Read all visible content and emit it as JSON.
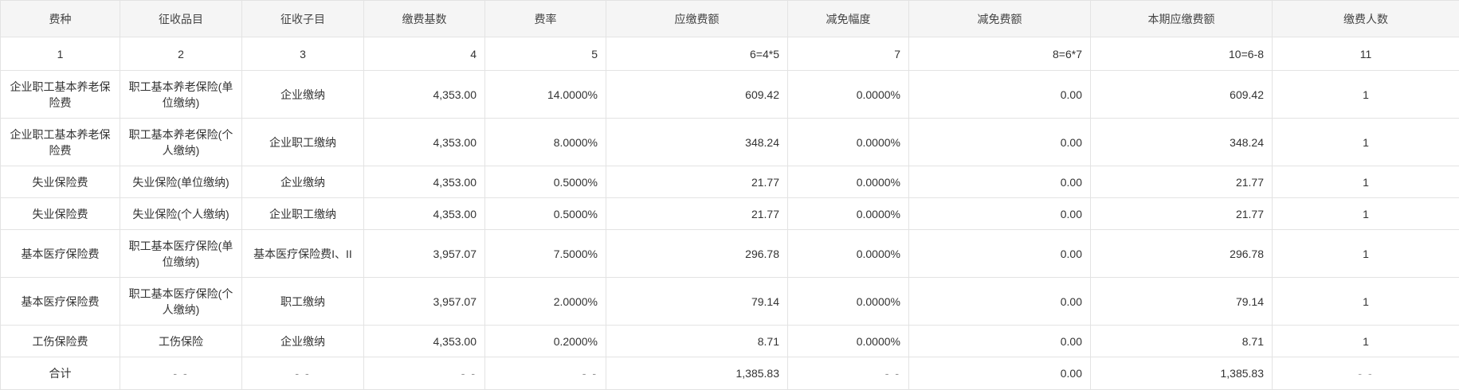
{
  "columns": [
    "费种",
    "征收品目",
    "征收子目",
    "缴费基数",
    "费率",
    "应缴费额",
    "减免幅度",
    "减免费额",
    "本期应缴费额",
    "缴费人数"
  ],
  "index_row": [
    "1",
    "2",
    "3",
    "4",
    "5",
    "6=4*5",
    "7",
    "8=6*7",
    "10=6-8",
    "11"
  ],
  "rows": [
    {
      "fee_type": "企业职工基本养老保险费",
      "item": "职工基本养老保险(单位缴纳)",
      "sub_item": "企业缴纳",
      "base": "4,353.00",
      "rate": "14.0000%",
      "payable": "609.42",
      "reduction_rate": "0.0000%",
      "reduction_amount": "0.00",
      "current_payable": "609.42",
      "payers": "1"
    },
    {
      "fee_type": "企业职工基本养老保险费",
      "item": "职工基本养老保险(个人缴纳)",
      "sub_item": "企业职工缴纳",
      "base": "4,353.00",
      "rate": "8.0000%",
      "payable": "348.24",
      "reduction_rate": "0.0000%",
      "reduction_amount": "0.00",
      "current_payable": "348.24",
      "payers": "1"
    },
    {
      "fee_type": "失业保险费",
      "item": "失业保险(单位缴纳)",
      "sub_item": "企业缴纳",
      "base": "4,353.00",
      "rate": "0.5000%",
      "payable": "21.77",
      "reduction_rate": "0.0000%",
      "reduction_amount": "0.00",
      "current_payable": "21.77",
      "payers": "1"
    },
    {
      "fee_type": "失业保险费",
      "item": "失业保险(个人缴纳)",
      "sub_item": "企业职工缴纳",
      "base": "4,353.00",
      "rate": "0.5000%",
      "payable": "21.77",
      "reduction_rate": "0.0000%",
      "reduction_amount": "0.00",
      "current_payable": "21.77",
      "payers": "1"
    },
    {
      "fee_type": "基本医疗保险费",
      "item": "职工基本医疗保险(单位缴纳)",
      "sub_item": "基本医疗保险费I、II",
      "base": "3,957.07",
      "rate": "7.5000%",
      "payable": "296.78",
      "reduction_rate": "0.0000%",
      "reduction_amount": "0.00",
      "current_payable": "296.78",
      "payers": "1"
    },
    {
      "fee_type": "基本医疗保险费",
      "item": "职工基本医疗保险(个人缴纳)",
      "sub_item": "职工缴纳",
      "base": "3,957.07",
      "rate": "2.0000%",
      "payable": "79.14",
      "reduction_rate": "0.0000%",
      "reduction_amount": "0.00",
      "current_payable": "79.14",
      "payers": "1"
    },
    {
      "fee_type": "工伤保险费",
      "item": "工伤保险",
      "sub_item": "企业缴纳",
      "base": "4,353.00",
      "rate": "0.2000%",
      "payable": "8.71",
      "reduction_rate": "0.0000%",
      "reduction_amount": "0.00",
      "current_payable": "8.71",
      "payers": "1"
    }
  ],
  "total": {
    "label": "合计",
    "item": "- -",
    "sub_item": "- -",
    "base": "- -",
    "rate": "- -",
    "payable": "1,385.83",
    "reduction_rate": "- -",
    "reduction_amount": "0.00",
    "current_payable": "1,385.83",
    "payers": "- -"
  }
}
